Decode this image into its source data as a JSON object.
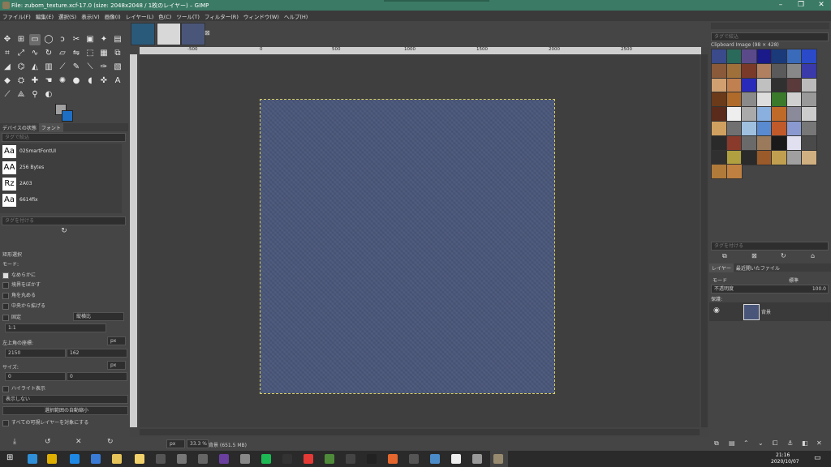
{
  "window": {
    "title": "File: zubom_texture.xcf-17.0 (size: 2048x2048 / 1枚のレイヤー) – GIMP",
    "minimize": "–",
    "maximize": "❐",
    "close": "✕"
  },
  "menu": [
    "ファイル(F)",
    "編集(E)",
    "選択(S)",
    "表示(V)",
    "画像(I)",
    "レイヤー(L)",
    "色(C)",
    "ツール(T)",
    "フィルター(R)",
    "ウィンドウ(W)",
    "ヘルプ(H)"
  ],
  "fonts_dock": {
    "tabs": [
      "デバイスの状態",
      "フォント"
    ],
    "tag_filter_placeholder": "タグで絞込",
    "fonts": [
      {
        "sample": "Aa",
        "name": "02SmartFontUI"
      },
      {
        "sample": "AA",
        "name": "256 Bytes"
      },
      {
        "sample": "Rz",
        "name": "2A03"
      },
      {
        "sample": "Aa",
        "name": "6614fix"
      }
    ],
    "tag_assign_placeholder": "タグを付ける"
  },
  "tool_options": {
    "title": "矩形選択",
    "mode_label": "モード:",
    "antialias": "なめらかに",
    "feather": "境界をぼかす",
    "rounded": "角を丸める",
    "expand_center": "中央から拡げる",
    "fixed_label": "固定",
    "fixed_value": "縦横比",
    "ratio_value": "1:1",
    "position_label": "左上角の座標:",
    "pos_x": "2150",
    "pos_y": "162",
    "unit": "px",
    "size_label": "サイズ:",
    "size_w": "0",
    "size_h": "0",
    "highlight": "ハイライト表示",
    "guides_value": "表示しない",
    "auto_shrink": "選択範囲の自動縮小",
    "all_layers": "すべての可視レイヤーを対象にする"
  },
  "rulers": {
    "h_ticks": [
      "-500",
      "0",
      "500",
      "1000",
      "1500",
      "2000",
      "2500"
    ]
  },
  "status": {
    "unit": "px",
    "zoom": "33.3 %",
    "info": "背景 (651.5 MB)"
  },
  "patterns_dock": {
    "tag_filter_placeholder": "タグで絞込",
    "current_pattern": "Clipboard Image (98 × 428)",
    "tag_assign_placeholder": "タグを付ける"
  },
  "layers_dock": {
    "tabs": [
      "レイヤー",
      "最近開いたファイル"
    ],
    "mode_label": "モード",
    "mode_value": "標準",
    "opacity_label": "不透明度",
    "opacity_value": "100.0",
    "lock_label": "保護:",
    "layers": [
      {
        "name": "背景"
      }
    ]
  },
  "taskbar": {
    "time": "21:16",
    "date": "2020/10/07"
  },
  "colors": {
    "fg": "#a0a0a0",
    "bg": "#1d6fc4",
    "titlebar": "#3b7a64",
    "image": "#4a5679"
  }
}
